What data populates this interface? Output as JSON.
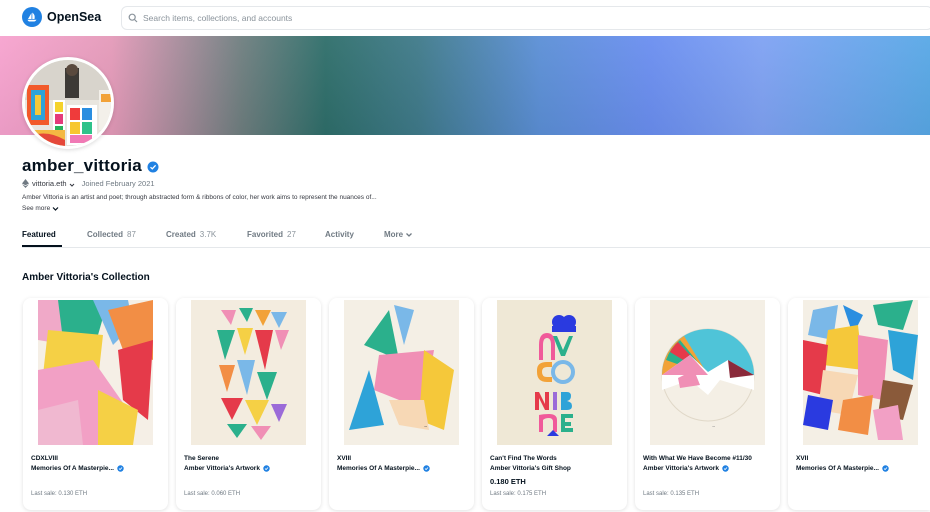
{
  "header": {
    "brand": "OpenSea",
    "search_placeholder": "Search items, collections, and accounts"
  },
  "profile": {
    "username": "amber_vittoria",
    "ens": "vittoria.eth",
    "joined": "Joined February 2021",
    "bio": "Amber Vittoria is an artist and poet; through abstracted form & ribbons of color, her work aims to represent the nuances of...",
    "see_more": "See more"
  },
  "tabs": [
    {
      "label": "Featured",
      "count": ""
    },
    {
      "label": "Collected",
      "count": "87"
    },
    {
      "label": "Created",
      "count": "3.7K"
    },
    {
      "label": "Favorited",
      "count": "27"
    },
    {
      "label": "Activity",
      "count": ""
    },
    {
      "label": "More",
      "count": ""
    }
  ],
  "collection": {
    "title": "Amber Vittoria's Collection",
    "items": [
      {
        "title": "CDXLVIII",
        "collection": "Memories Of A Masterpie...",
        "price": "",
        "last_sale": "Last sale: 0.130 ETH"
      },
      {
        "title": "The Serene",
        "collection": "Amber Vittoria's Artwork",
        "price": "",
        "last_sale": "Last sale: 0.060 ETH"
      },
      {
        "title": "XVIII",
        "collection": "Memories Of A Masterpie...",
        "price": "",
        "last_sale": ""
      },
      {
        "title": "Can't Find The Words",
        "collection": "Amber Vittoria's Gift Shop",
        "price": "0.180 ETH",
        "last_sale": "Last sale: 0.175 ETH"
      },
      {
        "title": "With What We Have Become #11/30",
        "collection": "Amber Vittoria's Artwork",
        "price": "",
        "last_sale": "Last sale: 0.135 ETH"
      },
      {
        "title": "XVII",
        "collection": "Memories Of A Masterpie...",
        "price": "",
        "last_sale": ""
      }
    ]
  },
  "colors": {
    "accent": "#2081e2",
    "text": "#04111d",
    "muted": "#707a83"
  }
}
